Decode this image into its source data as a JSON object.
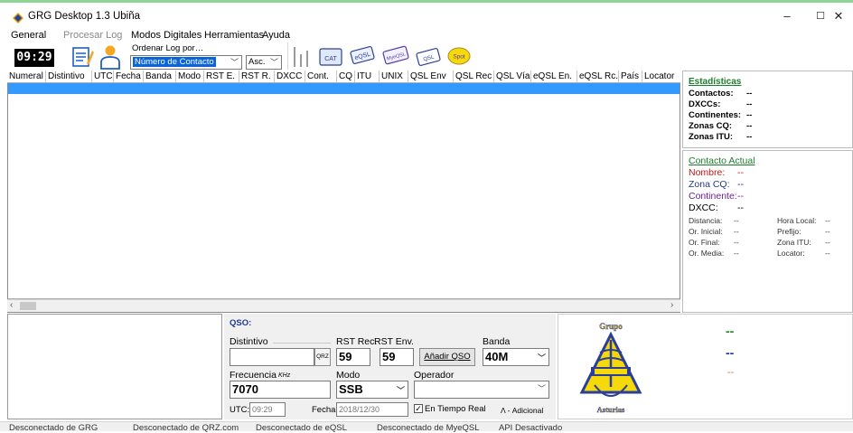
{
  "window": {
    "title": "GRG Desktop 1.3 Ubiña",
    "minimize": "–",
    "maximize": "☐",
    "close": "✕"
  },
  "menu": [
    "General",
    "Procesar Log",
    "Modos Digitales",
    "Herramientas",
    "Ayuda"
  ],
  "toolbar": {
    "clock": "09:29",
    "sort_label": "Ordenar Log por…",
    "sort_value": "Número de Contacto",
    "order_value": "Asc.",
    "buttons": {
      "cat": "CAT",
      "eqsl": "eQSL",
      "mycqsl": "MyeQSL",
      "qsl": "QSL",
      "spot": "Spot"
    }
  },
  "grid": {
    "columns": [
      "Numeral",
      "Distintivo",
      "UTC",
      "Fecha",
      "Banda",
      "Modo",
      "RST E.",
      "RST R.",
      "DXCC",
      "Cont.",
      "CQ",
      "ITU",
      "UNIX",
      "QSL Env",
      "QSL Rec",
      "QSL Vía",
      "eQSL En.",
      "eQSL Rc.",
      "País",
      "Locator"
    ]
  },
  "stats": {
    "title": "Estadísticas",
    "rows": [
      {
        "label": "Contactos:",
        "value": "--"
      },
      {
        "label": "DXCCs:",
        "value": "--"
      },
      {
        "label": "Continentes:",
        "value": "--"
      },
      {
        "label": "Zonas CQ:",
        "value": "--"
      },
      {
        "label": "Zonas ITU:",
        "value": "--"
      }
    ]
  },
  "contact": {
    "title": "Contacto Actual",
    "nombre_label": "Nombre:",
    "nombre_value": "--",
    "zonacq_label": "Zona CQ:",
    "zonacq_value": "--",
    "continente_label": "Continente:",
    "continente_value": "--",
    "dxcc_label": "DXCC:",
    "dxcc_value": "--",
    "left": [
      {
        "label": "Distancia:",
        "value": "--"
      },
      {
        "label": "Or. Inicial:",
        "value": "--"
      },
      {
        "label": "Or. Final:",
        "value": "--"
      },
      {
        "label": "Or. Media:",
        "value": "--"
      }
    ],
    "right": [
      {
        "label": "Hora Local:",
        "value": "--"
      },
      {
        "label": "Prefijo:",
        "value": "--"
      },
      {
        "label": "Zona ITU:",
        "value": "--"
      },
      {
        "label": "Locator:",
        "value": "--"
      }
    ]
  },
  "qso": {
    "title": "QSO:",
    "distintivo_label": "Distintivo",
    "qrz_label": "QRZ",
    "rst_rec_label": "RST Rec.",
    "rst_rec_value": "59",
    "rst_env_label": "RST Env.",
    "rst_env_value": "59",
    "add_button": "Añadir QSO",
    "banda_label": "Banda",
    "banda_value": "40M",
    "frecuencia_label": "Frecuencia",
    "frecuencia_unit": "KHz",
    "frecuencia_value": "7070",
    "modo_label": "Modo",
    "modo_value": "SSB",
    "operador_label": "Operador",
    "utc_label": "UTC:",
    "utc_value": "09:29",
    "fecha_label": "Fecha:",
    "fecha_value": "2018/12/30",
    "tiempo_real_label": "En Tiempo Real",
    "adicional_label": "Λ - Adicional"
  },
  "logo": {
    "top_text": "Grupo",
    "bottom_text": "Asturias",
    "line1": "--",
    "line2": "--",
    "line3": "--"
  },
  "status": [
    "Desconectado de GRG",
    "Desconectado de QRZ.com",
    "Desconectado de eQSL",
    "Desconectado de MyeQSL",
    "API Desactivado"
  ],
  "colors": {
    "accent": "#8fd694",
    "selection": "#3399ff",
    "link": "#1a7f2a",
    "header_blue": "#1f3a93",
    "logo_yellow": "#f5d90a",
    "logo_blue": "#2b3f9a"
  }
}
